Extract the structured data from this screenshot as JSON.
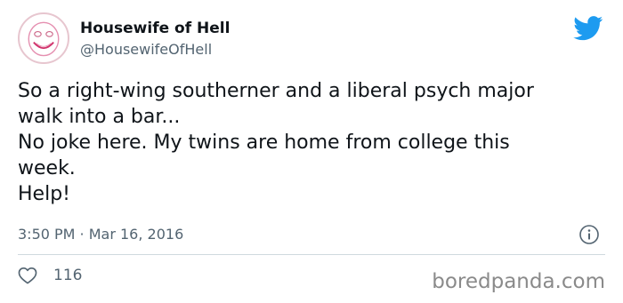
{
  "author": {
    "display_name": "Housewife of Hell",
    "handle": "@HousewifeOfHell"
  },
  "icons": {
    "brand": "twitter-bird-icon",
    "info": "info-icon",
    "like": "heart-icon"
  },
  "colors": {
    "twitter_blue": "#1d9bf0",
    "secondary_text": "#536471"
  },
  "tweet": {
    "lines": [
      "So a right-wing southerner and a liberal psych major",
      "walk into a bar...",
      "No joke here. My twins are home from college this",
      "week.",
      "Help!"
    ]
  },
  "meta": {
    "timestamp": "3:50 PM · Mar 16, 2016"
  },
  "actions": {
    "likes": "116"
  },
  "watermark": "boredpanda.com"
}
